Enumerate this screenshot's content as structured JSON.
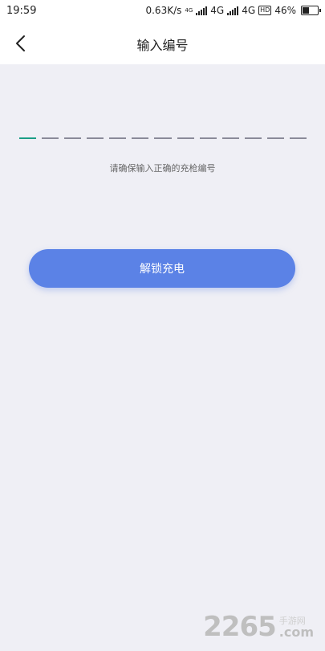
{
  "status_bar": {
    "time": "19:59",
    "speed": "0.63K/s",
    "net_mini": "4G",
    "net1": "4G",
    "net2": "4G",
    "hd": "HD",
    "battery_text": "46%",
    "battery_level": 0.46
  },
  "nav": {
    "back_icon": "chevron-left-icon",
    "title": "输入编号"
  },
  "code_input": {
    "slot_count": 13,
    "filled": 0,
    "active_color": "#1b9e86",
    "inactive_color": "#8a8a99"
  },
  "hint": "请确保输入正确的充枪编号",
  "unlock_button": {
    "label": "解锁充电",
    "color": "#5b82e6"
  },
  "watermark": {
    "number": "2265",
    "cn": "手游网",
    "com": ".com"
  }
}
